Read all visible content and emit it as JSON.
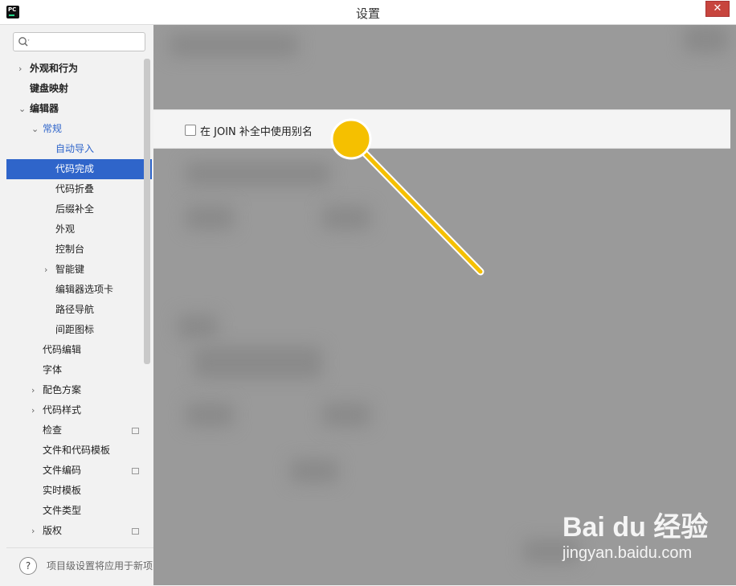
{
  "window": {
    "title": "设置",
    "close_symbol": "✕"
  },
  "sidebar": {
    "search_placeholder": "",
    "items": [
      {
        "label": "外观和行为",
        "level": 0,
        "expander": "›",
        "bold": true
      },
      {
        "label": "键盘映射",
        "level": 0,
        "bold": true
      },
      {
        "label": "编辑器",
        "level": 0,
        "expander": "⌄",
        "bold": true
      },
      {
        "label": "常规",
        "level": 1,
        "expander": "⌄",
        "blue": true
      },
      {
        "label": "自动导入",
        "level": 2,
        "blue": true
      },
      {
        "label": "代码完成",
        "level": 2,
        "selected": true
      },
      {
        "label": "代码折叠",
        "level": 2
      },
      {
        "label": "后缀补全",
        "level": 2
      },
      {
        "label": "外观",
        "level": 2
      },
      {
        "label": "控制台",
        "level": 2
      },
      {
        "label": "智能键",
        "level": 2,
        "expander": "›"
      },
      {
        "label": "编辑器选项卡",
        "level": 2
      },
      {
        "label": "路径导航",
        "level": 2
      },
      {
        "label": "间距图标",
        "level": 2
      },
      {
        "label": "代码编辑",
        "level": 1
      },
      {
        "label": "字体",
        "level": 1
      },
      {
        "label": "配色方案",
        "level": 1,
        "expander": "›"
      },
      {
        "label": "代码样式",
        "level": 1,
        "expander": "›"
      },
      {
        "label": "检查",
        "level": 1,
        "badge": true
      },
      {
        "label": "文件和代码模板",
        "level": 1
      },
      {
        "label": "文件编码",
        "level": 1,
        "badge": true
      },
      {
        "label": "实时模板",
        "level": 1
      },
      {
        "label": "文件类型",
        "level": 1
      },
      {
        "label": "版权",
        "level": 1,
        "expander": "›",
        "badge": true
      }
    ],
    "help_symbol": "?",
    "help_text": "项目级设置将应用于新项"
  },
  "main": {
    "option_label": "在 JOIN 补全中使用别名",
    "option_checked": false
  },
  "watermark": {
    "brand": "Bai du 经验",
    "url": "jingyan.baidu.com"
  },
  "colors": {
    "selection": "#2f65ca",
    "annotation": "#f5c000",
    "close": "#c7453e"
  }
}
